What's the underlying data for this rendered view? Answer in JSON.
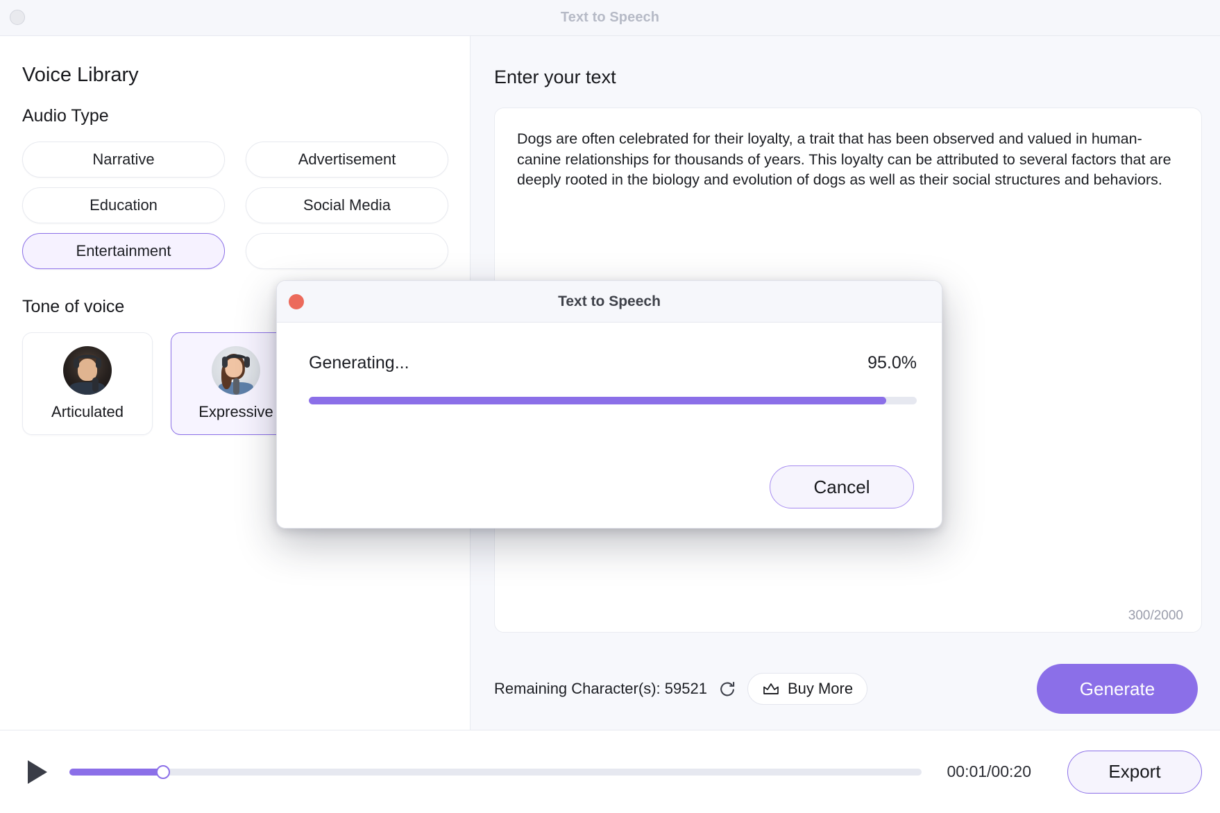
{
  "window": {
    "title": "Text to Speech",
    "traffic_dot": "window-dot"
  },
  "sidebar": {
    "heading": "Voice Library",
    "audio_type": {
      "label": "Audio Type",
      "items": [
        {
          "label": "Narrative",
          "selected": false
        },
        {
          "label": "Advertisement",
          "selected": false
        },
        {
          "label": "Education",
          "selected": false
        },
        {
          "label": "Social Media",
          "selected": false
        },
        {
          "label": "Entertainment",
          "selected": true
        },
        {
          "label": "",
          "selected": false
        }
      ]
    },
    "tone_of_voice": {
      "label": "Tone of voice",
      "items": [
        {
          "label": "Articulated",
          "selected": false,
          "avatar": "male-podcaster-avatar"
        },
        {
          "label": "Expressive",
          "selected": true,
          "avatar": "female-singer-avatar"
        },
        {
          "label": "",
          "selected": false,
          "avatar": ""
        }
      ]
    }
  },
  "editor": {
    "heading": "Enter your text",
    "value": "Dogs are often celebrated for their loyalty, a trait that has been observed and valued in human-canine relationships for thousands of years. This loyalty can be attributed to several factors that are deeply rooted in the biology and evolution of dogs as well as their social structures and behaviors.",
    "placeholder": "Enter your text",
    "char_counter": "300/2000"
  },
  "footer": {
    "remaining_label": "Remaining Character(s): 59521",
    "refresh_icon": "refresh-icon",
    "buy_more_label": "Buy More",
    "buy_more_icon": "crown-icon",
    "generate_label": "Generate"
  },
  "playbar": {
    "play_icon": "play-icon",
    "progress_percent": 11,
    "time_label": "00:01/00:20",
    "export_label": "Export"
  },
  "modal": {
    "title": "Text to Speech",
    "close_icon": "close-icon",
    "status_label": "Generating...",
    "percent_label": "95.0%",
    "percent_value": 95,
    "cancel_label": "Cancel"
  },
  "colors": {
    "accent": "#8b6fe8",
    "accent_soft": "#f6f2ff",
    "close_red": "#ec6a5b",
    "track": "#e6e8f0",
    "panel_bg": "#f7f8fc"
  }
}
